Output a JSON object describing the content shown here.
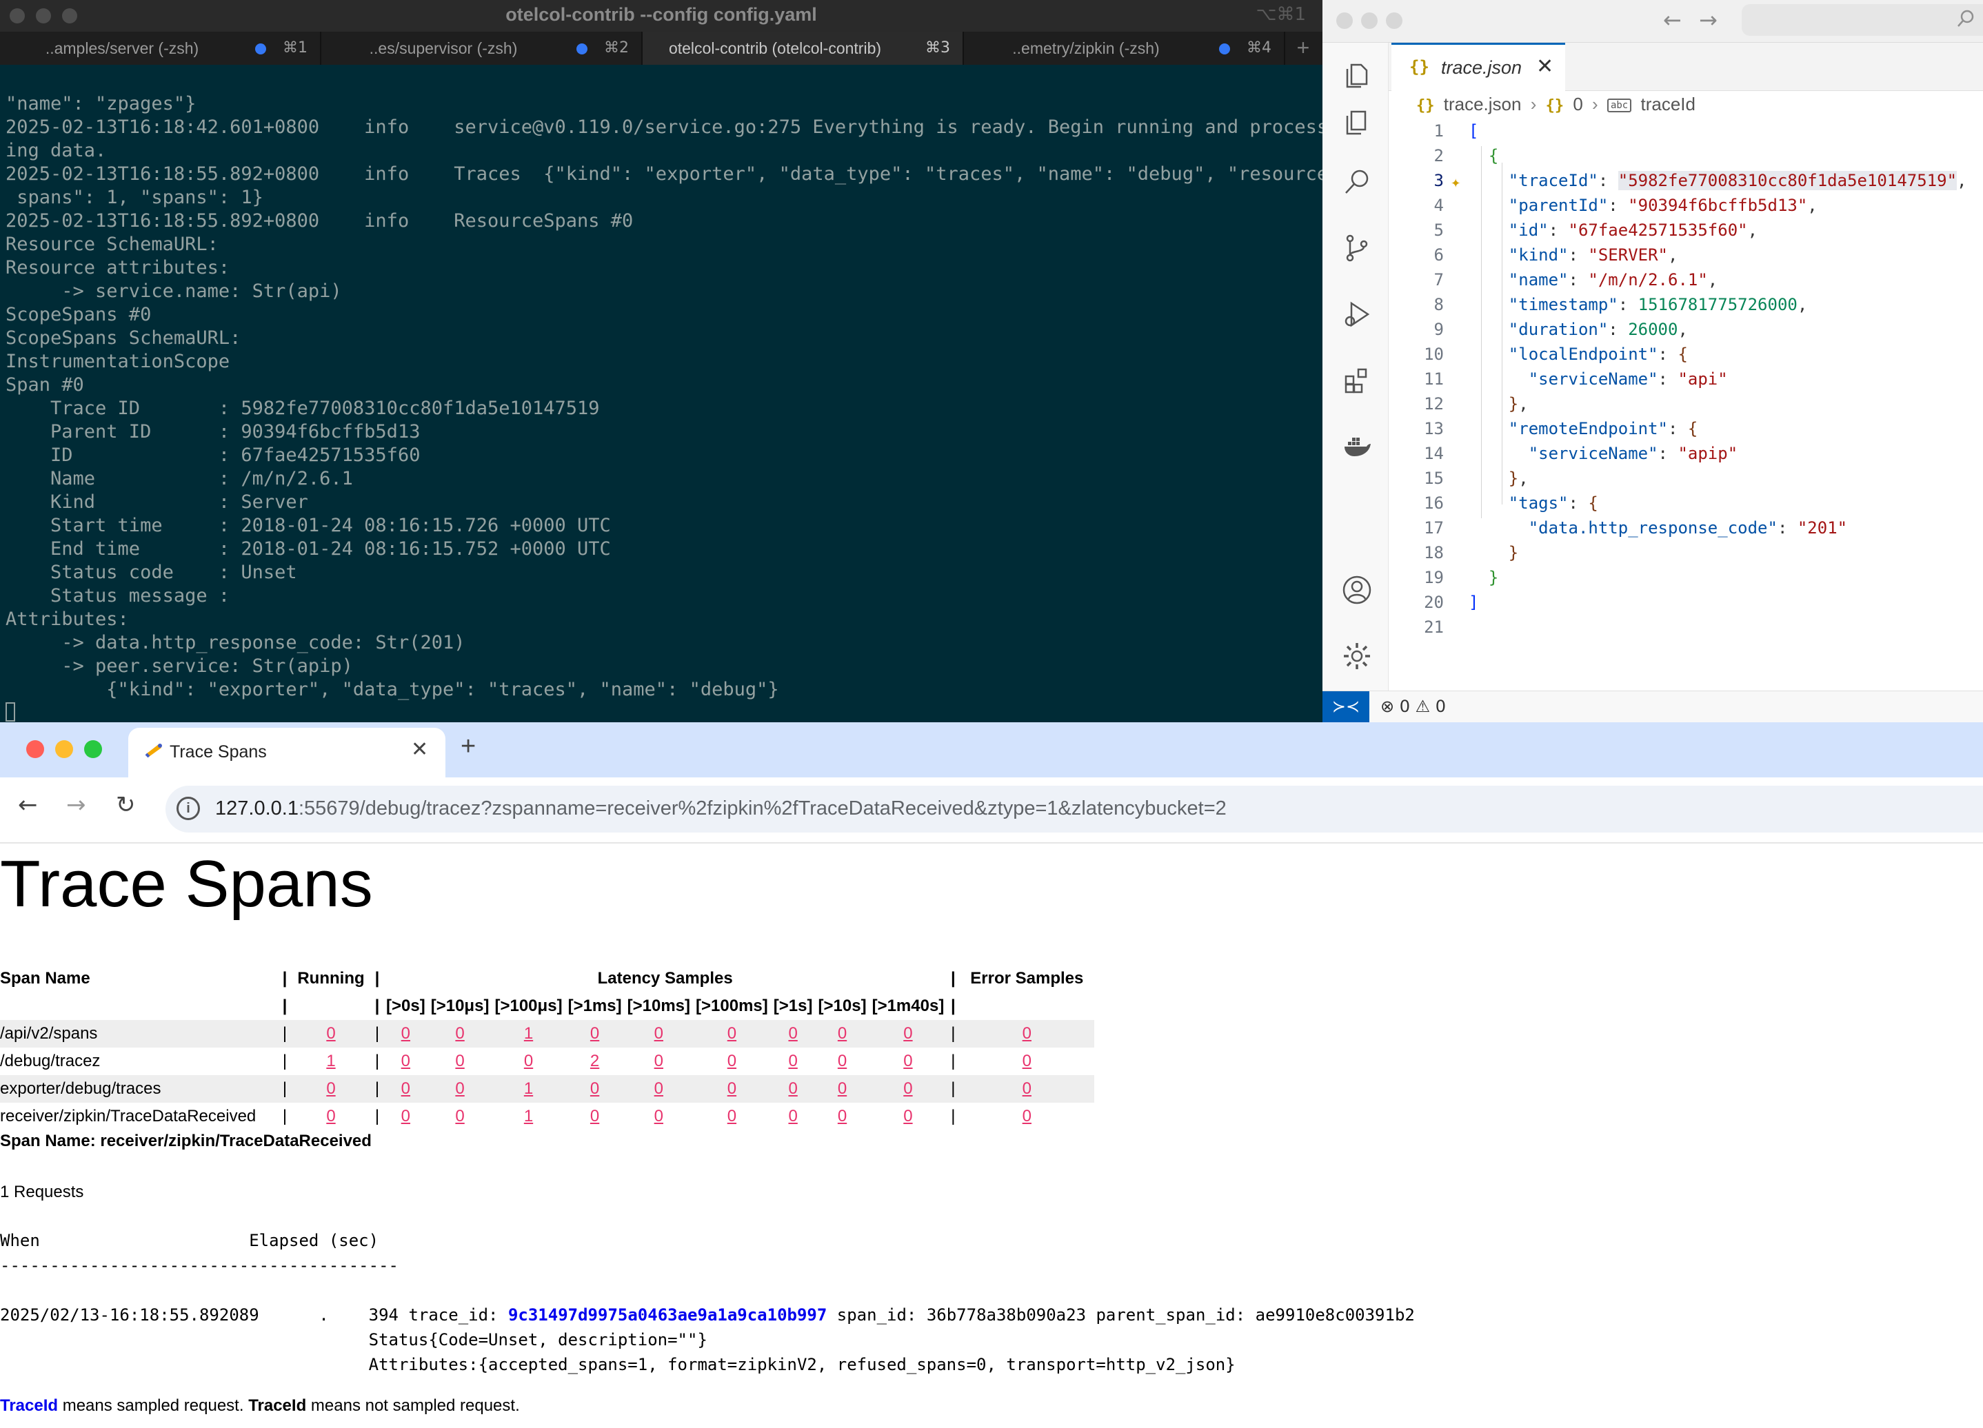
{
  "terminal": {
    "title": "otelcol-contrib --config config.yaml",
    "shortcut": "⌥⌘1",
    "tabs": [
      {
        "label": "..amples/server (-zsh)",
        "key": "⌘1",
        "dot": true
      },
      {
        "label": "..es/supervisor (-zsh)",
        "key": "⌘2",
        "dot": true
      },
      {
        "label": "otelcol-contrib (otelcol-contrib)",
        "key": "⌘3",
        "dot": false
      },
      {
        "label": "..emetry/zipkin (-zsh)",
        "key": "⌘4",
        "dot": true
      }
    ],
    "plus": "+",
    "lines": [
      "\"name\": \"zpages\"}",
      "2025-02-13T16:18:42.601+0800    info    service@v0.119.0/service.go:275 Everything is ready. Begin running and process",
      "ing data.",
      "2025-02-13T16:18:55.892+0800    info    Traces  {\"kind\": \"exporter\", \"data_type\": \"traces\", \"name\": \"debug\", \"resource",
      " spans\": 1, \"spans\": 1}",
      "2025-02-13T16:18:55.892+0800    info    ResourceSpans #0",
      "Resource SchemaURL:",
      "Resource attributes:",
      "     -> service.name: Str(api)",
      "ScopeSpans #0",
      "ScopeSpans SchemaURL:",
      "InstrumentationScope",
      "Span #0",
      "    Trace ID       : 5982fe77008310cc80f1da5e10147519",
      "    Parent ID      : 90394f6bcffb5d13",
      "    ID             : 67fae42571535f60",
      "    Name           : /m/n/2.6.1",
      "    Kind           : Server",
      "    Start time     : 2018-01-24 08:16:15.726 +0000 UTC",
      "    End time       : 2018-01-24 08:16:15.752 +0000 UTC",
      "    Status code    : Unset",
      "    Status message :",
      "Attributes:",
      "     -> data.http_response_code: Str(201)",
      "     -> peer.service: Str(apip)",
      "         {\"kind\": \"exporter\", \"data_type\": \"traces\", \"name\": \"debug\"}"
    ]
  },
  "vscode": {
    "tab": {
      "icon": "{}",
      "name": "trace.json",
      "close": "✕"
    },
    "breadcrumb": {
      "file": "trace.json",
      "index": "0",
      "key": "traceId",
      "brace": "{}",
      "file_icon": "{}",
      "ab": "abc"
    },
    "status": {
      "problems": "⊗ 0 ⚠ 0",
      "remote": "≻≺"
    },
    "nav": {
      "back": "←",
      "forward": "→"
    },
    "code": {
      "traceId_key": "\"traceId\"",
      "traceId_val": "\"5982fe77008310cc80f1da5e10147519\"",
      "parentId_key": "\"parentId\"",
      "parentId_val": "\"90394f6bcffb5d13\"",
      "id_key": "\"id\"",
      "id_val": "\"67fae42571535f60\"",
      "kind_key": "\"kind\"",
      "kind_val": "\"SERVER\"",
      "name_key": "\"name\"",
      "name_val": "\"/m/n/2.6.1\"",
      "timestamp_key": "\"timestamp\"",
      "timestamp_val": "1516781775726000",
      "duration_key": "\"duration\"",
      "duration_val": "26000",
      "localEndpoint_key": "\"localEndpoint\"",
      "serviceName_key": "\"serviceName\"",
      "local_service_val": "\"api\"",
      "remoteEndpoint_key": "\"remoteEndpoint\"",
      "remote_service_val": "\"apip\"",
      "tags_key": "\"tags\"",
      "tag_key": "\"data.http_response_code\"",
      "tag_val": "\"201\""
    },
    "line_numbers": [
      "1",
      "2",
      "3",
      "4",
      "5",
      "6",
      "7",
      "8",
      "9",
      "10",
      "11",
      "12",
      "13",
      "14",
      "15",
      "16",
      "17",
      "18",
      "19",
      "20",
      "21"
    ]
  },
  "browser": {
    "tab_title": "Trace Spans",
    "tab_close": "✕",
    "new_tab": "+",
    "url_host": "127.0.0.1",
    "url_rest": ":55679/debug/tracez?zspanname=receiver%2fzipkin%2fTraceDataReceived&ztype=1&zlatencybucket=2",
    "nav": {
      "back": "←",
      "forward": "→",
      "reload": "↻",
      "info": "i"
    },
    "page": {
      "title": "Trace Spans",
      "table": {
        "h_span_name": "Span Name",
        "h_running": "Running",
        "h_latency": "Latency Samples",
        "h_error": "Error Samples",
        "separator": "|",
        "buckets": [
          ">0s",
          ">10μs",
          ">100μs",
          ">1ms",
          ">10ms",
          ">100ms",
          ">1s",
          ">10s",
          ">1m40s"
        ],
        "rows": [
          {
            "name": "/api/v2/spans",
            "running": "0",
            "latency": [
              "0",
              "0",
              "1",
              "0",
              "0",
              "0",
              "0",
              "0",
              "0"
            ],
            "error": "0"
          },
          {
            "name": "/debug/tracez",
            "running": "1",
            "latency": [
              "0",
              "0",
              "0",
              "2",
              "0",
              "0",
              "0",
              "0",
              "0"
            ],
            "error": "0"
          },
          {
            "name": "exporter/debug/traces",
            "running": "0",
            "latency": [
              "0",
              "0",
              "1",
              "0",
              "0",
              "0",
              "0",
              "0",
              "0"
            ],
            "error": "0"
          },
          {
            "name": "receiver/zipkin/TraceDataReceived",
            "running": "0",
            "latency": [
              "0",
              "0",
              "1",
              "0",
              "0",
              "0",
              "0",
              "0",
              "0"
            ],
            "error": "0"
          }
        ]
      },
      "span_heading": "Span Name: receiver/zipkin/TraceDataReceived",
      "requests": "1 Requests",
      "col_when": "When",
      "col_elapsed": "Elapsed (sec)",
      "divider": "----------------------------------------",
      "req_time": "2025/02/13-16:18:55.892089",
      "req_elapsed_a": ".",
      "req_elapsed_b": "394",
      "trace_label": "trace_id:",
      "trace_id": "9c31497d9975a0463ae9a1a9ca10b997",
      "span_part": "span_id: 36b778a38b090a23 parent_span_id: ae9910e8c00391b2",
      "status_line": "Status{Code=Unset, description=\"\"}",
      "attributes_line": "Attributes:{accepted_spans=1, format=zipkinV2, refused_spans=0, transport=http_v2_json}",
      "legend_sampled": "TraceId",
      "legend_text1": " means sampled request. ",
      "legend_notsampled": "TraceId",
      "legend_text2": " means not sampled request."
    }
  }
}
